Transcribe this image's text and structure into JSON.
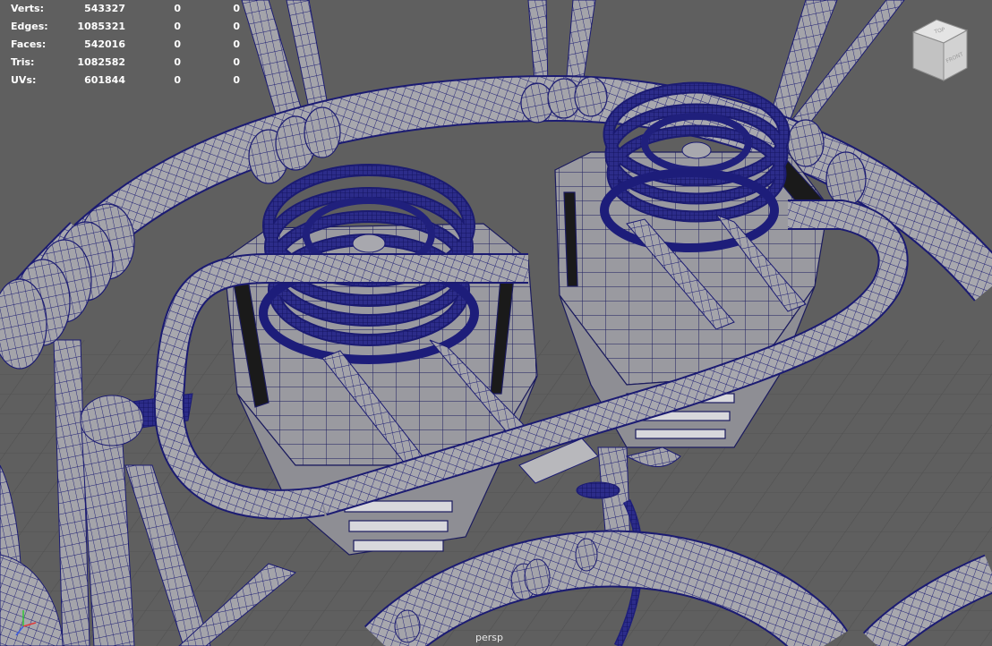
{
  "hud": {
    "rows": [
      {
        "label": "Verts:",
        "total": "543327",
        "selected": "0",
        "count": "0"
      },
      {
        "label": "Edges:",
        "total": "1085321",
        "selected": "0",
        "count": "0"
      },
      {
        "label": "Faces:",
        "total": "542016",
        "selected": "0",
        "count": "0"
      },
      {
        "label": "Tris:",
        "total": "1082582",
        "selected": "0",
        "count": "0"
      },
      {
        "label": "UVs:",
        "total": "601844",
        "selected": "0",
        "count": "0"
      }
    ]
  },
  "viewcube": {
    "top_label": "TOP",
    "front_label": "FRONT"
  },
  "camera": {
    "label": "persp"
  },
  "colors": {
    "background": "#5f5f5f",
    "wire": "#1a1a6e",
    "shade": "#a9a9ad",
    "floor_grid": "#555555"
  },
  "icons": {
    "axis": "axis-gizmo-icon",
    "viewcube": "view-cube-icon"
  }
}
